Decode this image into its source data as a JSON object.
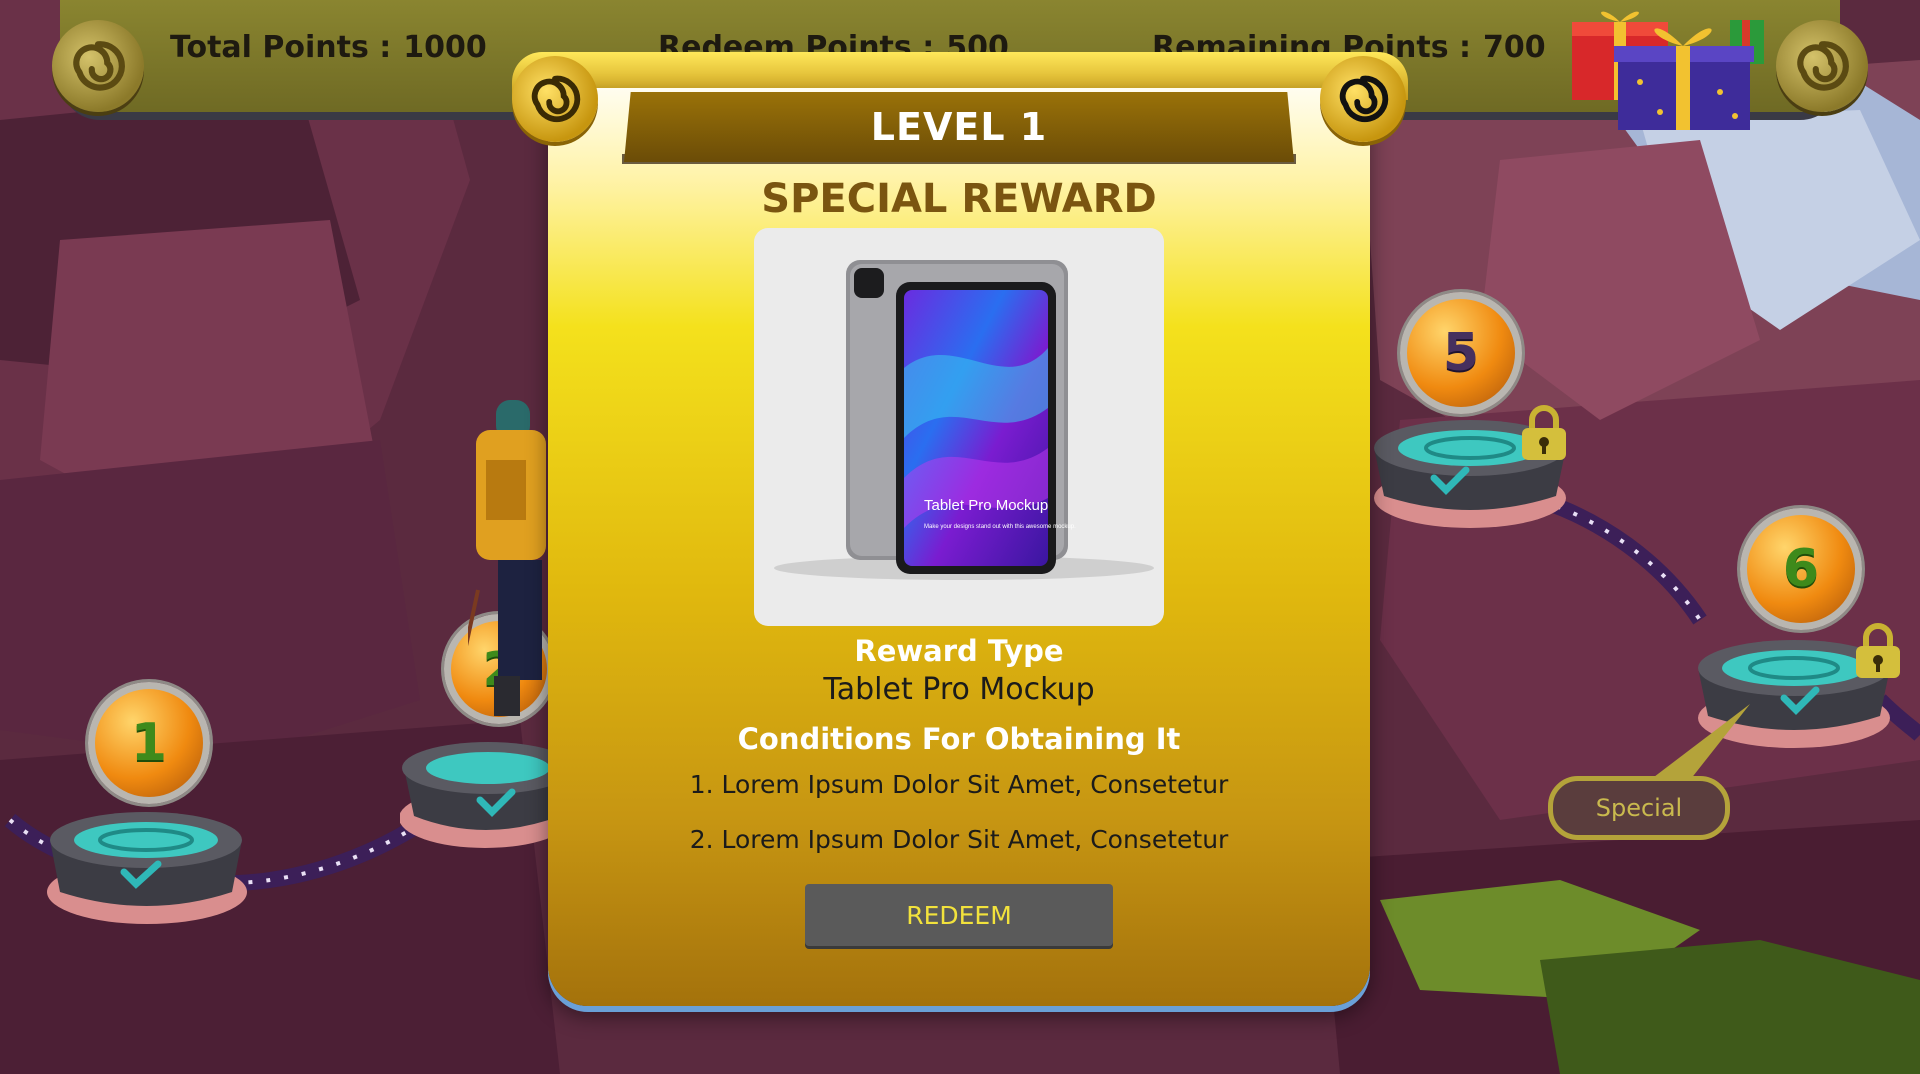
{
  "topbar": {
    "total_points_label": "Total Points :",
    "total_points_value": "1000",
    "redeem_points_label": "Redeem Points :",
    "redeem_points_value": "500",
    "remaining_points_label": "Remaining Points :",
    "remaining_points_value": "700"
  },
  "levels": [
    {
      "number": "1",
      "status": "completed"
    },
    {
      "number": "2",
      "status": "completed"
    },
    {
      "number": "5",
      "status": "locked"
    },
    {
      "number": "6",
      "status": "locked"
    }
  ],
  "special_tag": "Special",
  "modal": {
    "level_title": "LEVEL 1",
    "reward_heading": "SPECIAL REWARD",
    "product_image_caption": "Tablet Pro Mockup",
    "product_image_subcaption": "Make your designs stand out with this awesome mockup.",
    "reward_type_label": "Reward Type",
    "reward_type_value": "Tablet Pro Mockup",
    "conditions_label": "Conditions For Obtaining It",
    "conditions": [
      "1. Lorem Ipsum Dolor Sit Amet,  Consetetur",
      "2. Lorem Ipsum Dolor Sit Amet,  Consetetur"
    ],
    "redeem_label": "REDEEM"
  },
  "colors": {
    "accent_gold": "#f4e11c",
    "banner_brown": "#7a5510",
    "button_gray": "#5a5a5a",
    "button_text": "#f2e23c"
  },
  "icons": [
    "swirl-icon",
    "gift-icon",
    "lock-icon",
    "checkmark-icon"
  ]
}
